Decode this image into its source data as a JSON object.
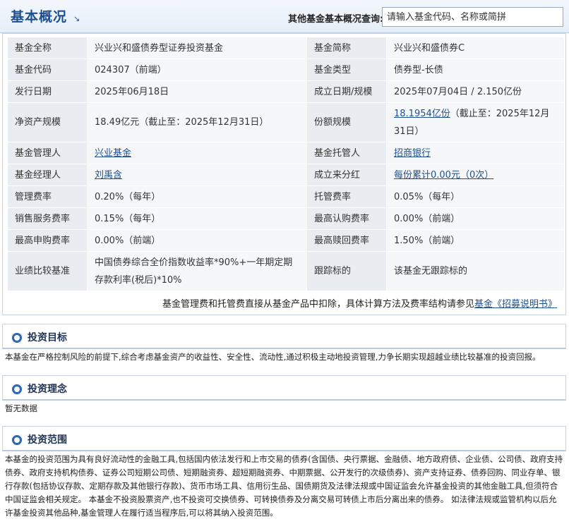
{
  "header": {
    "title": "基本概况",
    "title_arrow": "↘",
    "search_label": "其他基金基本概况查询:",
    "search_placeholder": "请输入基金代码、名称或简拼"
  },
  "info": {
    "rows": [
      {
        "l1": "基金全称",
        "v1": "兴业兴和盛债券型证券投资基金",
        "l2": "基金简称",
        "v2": "兴业兴和盛债券C"
      },
      {
        "l1": "基金代码",
        "v1": "024307（前端）",
        "l2": "基金类型",
        "v2": "债券型-长债"
      },
      {
        "l1": "发行日期",
        "v1": "2025年06月18日",
        "l2": "成立日期/规模",
        "v2": "2025年07月04日 / 2.150亿份"
      },
      {
        "l1": "净资产规模",
        "v1": "18.49亿元（截止至：2025年12月31日）",
        "l2": "份额规模",
        "v2_link": "18.1954亿份",
        "v2_rest": "（截止至：2025年12月31日）"
      },
      {
        "l1": "基金管理人",
        "v1_link": "兴业基金",
        "l2": "基金托管人",
        "v2_link": "招商银行"
      },
      {
        "l1": "基金经理人",
        "v1_link": "刘禹含",
        "l2": "成立来分红",
        "v2_link": "每份累计0.00元（0次）"
      },
      {
        "l1": "管理费率",
        "v1": "0.20%（每年）",
        "l2": "托管费率",
        "v2": "0.05%（每年）"
      },
      {
        "l1": "销售服务费率",
        "v1": "0.15%（每年）",
        "l2": "最高认购费率",
        "v2": "0.00%（前端）"
      },
      {
        "l1": "最高申购费率",
        "v1": "0.00%（前端）",
        "l2": "最高赎回费率",
        "v2": "1.50%（前端）"
      },
      {
        "l1": "业绩比较基准",
        "v1": "中国债券综合全价指数收益率*90%+一年期定期存款利率(税后)*10%",
        "l2": "跟踪标的",
        "v2": "该基金无跟踪标的"
      }
    ],
    "footnote_text": "基金管理费和托管费直接从基金产品中扣除，具体计算方法及费率结构请参见",
    "footnote_link": "基金《招募说明书》"
  },
  "sections": {
    "goal": {
      "title": "投资目标",
      "text": "本基金在严格控制风险的前提下,综合考虑基金资产的收益性、安全性、流动性,通过积极主动地投资管理,力争长期实现超越业绩比较基准的投资回报。"
    },
    "philosophy": {
      "title": "投资理念",
      "text": "暂无数据"
    },
    "scope": {
      "title": "投资范围",
      "text": "本基金的投资范围为具有良好流动性的金融工具,包括国内依法发行和上市交易的债券(含国债、央行票据、金融债、地方政府债、企业债、公司债、政府支持债券、政府支持机构债券、证券公司短期公司债、短期融资券、超短期融资券、中期票据、公开发行的次级债券)、资产支持证券、债券回购、同业存单、银行存款(包括协议存款、定期存款及其他银行存款)、货币市场工具、信用衍生品、国债期货及法律法规或中国证监会允许基金投资的其他金融工具,但须符合中国证监会相关规定。 本基金不投资股票资产,也不投资可交换债券、可转换债券及分离交易可转债上市后分离出来的债券。 如法律法规或监管机构以后允许基金投资其他品种,基金管理人在履行适当程序后,可以将其纳入投资范围。"
    }
  }
}
